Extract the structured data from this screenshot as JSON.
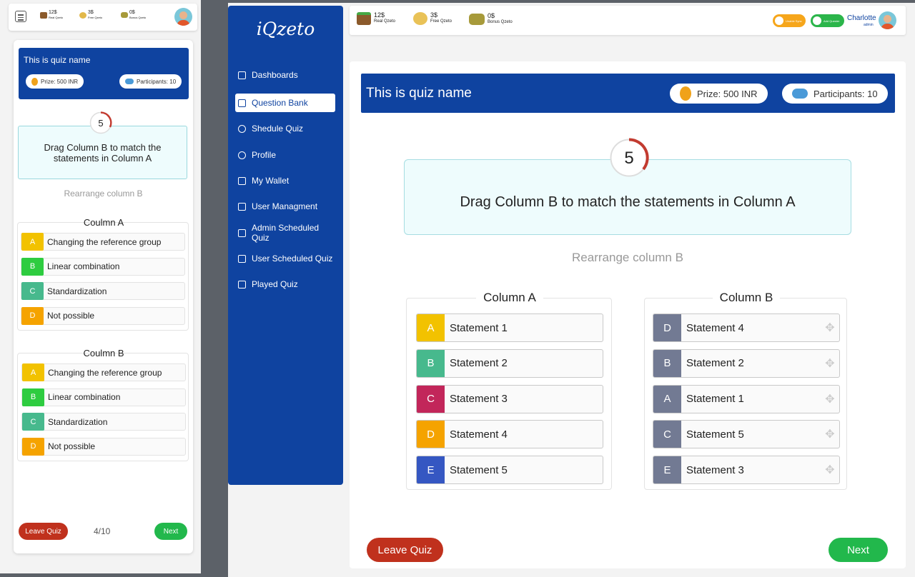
{
  "colors": {
    "brand": "#0f43a0",
    "leave": "#c0311d",
    "next": "#22b84c",
    "timer_ring": "#c23b30",
    "question_bg": "#eefcfd"
  },
  "wallet": {
    "real": {
      "amount": "12$",
      "label": "Real Qzeto",
      "icon": "wallet-icon"
    },
    "free": {
      "amount": "3$",
      "label": "Free Qzeto",
      "icon": "hand-coin-icon"
    },
    "bonus": {
      "amount": "0$",
      "label": "Bonus Qzeto",
      "icon": "coins-stack-icon"
    }
  },
  "app": {
    "logo": "iQzeto"
  },
  "nav": [
    {
      "label": "Dashboards",
      "icon": "home-icon"
    },
    {
      "label": "Question Bank",
      "icon": "cube-icon",
      "active": true
    },
    {
      "label": "Shedule Quiz",
      "icon": "clock-icon"
    },
    {
      "label": "Profile",
      "icon": "user-icon"
    },
    {
      "label": "My Wallet",
      "icon": "wallet-icon"
    },
    {
      "label": "User Managment",
      "icon": "user-gear-icon"
    },
    {
      "label": "Admin Scheduled Quiz",
      "icon": "calendar-gear-icon"
    },
    {
      "label": "User Scheduled Quiz",
      "icon": "calendar-user-icon"
    },
    {
      "label": "Played Quiz",
      "icon": "list-icon"
    }
  ],
  "header": {
    "toggle1_label": "Unable Sync",
    "toggle2_label": "Add Quester",
    "user_name": "Charlotte",
    "user_role": "admin"
  },
  "quiz": {
    "name": "This is quiz name",
    "prize": "Prize: 500 INR",
    "participants": "Participants: 10",
    "timer": "5",
    "question": "Drag Column B to match the statements in Column A",
    "instruction": "Rearrange column B",
    "progress": "4/10",
    "leave_label": "Leave Quiz",
    "next_label": "Next"
  },
  "desktop_columns": {
    "a_title": "Column A",
    "b_title": "Column B",
    "a_rows": [
      {
        "letter": "A",
        "text": "Statement 1",
        "color": "#f2c200"
      },
      {
        "letter": "B",
        "text": "Statement 2",
        "color": "#47b98d"
      },
      {
        "letter": "C",
        "text": "Statement 3",
        "color": "#c2265a"
      },
      {
        "letter": "D",
        "text": "Statement 4",
        "color": "#f5a300"
      },
      {
        "letter": "E",
        "text": "Statement 5",
        "color": "#3557c2"
      }
    ],
    "b_rows": [
      {
        "letter": "D",
        "text": "Statement 4",
        "color": "#727a93"
      },
      {
        "letter": "B",
        "text": "Statement 2",
        "color": "#727a93"
      },
      {
        "letter": "A",
        "text": "Statement 1",
        "color": "#727a93"
      },
      {
        "letter": "C",
        "text": "Statement 5",
        "color": "#727a93"
      },
      {
        "letter": "E",
        "text": "Statement 3",
        "color": "#727a93"
      }
    ]
  },
  "mobile_columns": {
    "a_title": "Coulmn A",
    "b_title": "Coulmn B",
    "a_rows": [
      {
        "letter": "A",
        "text": "Changing the reference group",
        "color": "#f2c200"
      },
      {
        "letter": "B",
        "text": "Linear combination",
        "color": "#2ecc40"
      },
      {
        "letter": "C",
        "text": "Standardization",
        "color": "#47b98d"
      },
      {
        "letter": "D",
        "text": "Not possible",
        "color": "#f5a300"
      }
    ],
    "b_rows": [
      {
        "letter": "A",
        "text": "Changing the reference group",
        "color": "#f2c200"
      },
      {
        "letter": "B",
        "text": "Linear combination",
        "color": "#2ecc40"
      },
      {
        "letter": "C",
        "text": "Standardization",
        "color": "#47b98d"
      },
      {
        "letter": "D",
        "text": "Not possible",
        "color": "#f5a300"
      }
    ]
  }
}
